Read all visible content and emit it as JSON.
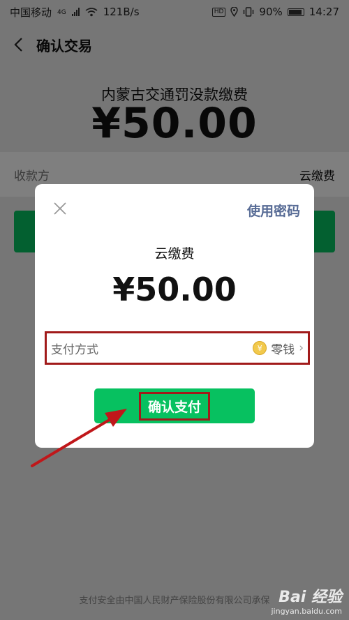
{
  "status_bar": {
    "carrier": "中国移动",
    "network": "4G",
    "speed": "121B/s",
    "hd_badge": "HD",
    "battery": "90%",
    "time": "14:27"
  },
  "nav": {
    "back_icon": "chevron-left-icon",
    "title": "确认交易"
  },
  "main": {
    "merchant": "内蒙古交通罚没款缴费",
    "amount": "¥50.00",
    "payee_label": "收款方",
    "payee_value": "云缴费"
  },
  "dialog": {
    "close_icon": "close-icon",
    "use_password": "使用密码",
    "merchant": "云缴费",
    "amount": "¥50.00",
    "payment_method_label": "支付方式",
    "payment_method_icon": "coin-icon",
    "payment_method_coin_symbol": "¥",
    "payment_method_value": "零钱",
    "confirm_button": "确认支付"
  },
  "footer": {
    "text": "支付安全由中国人民财产保险股份有限公司承保"
  },
  "watermark": {
    "logo": "Bai 经验",
    "url": "jingyan.baidu.com"
  },
  "colors": {
    "wechat_green": "#07c160",
    "link_blue": "#576b95",
    "highlight_red": "#a11a1a"
  }
}
